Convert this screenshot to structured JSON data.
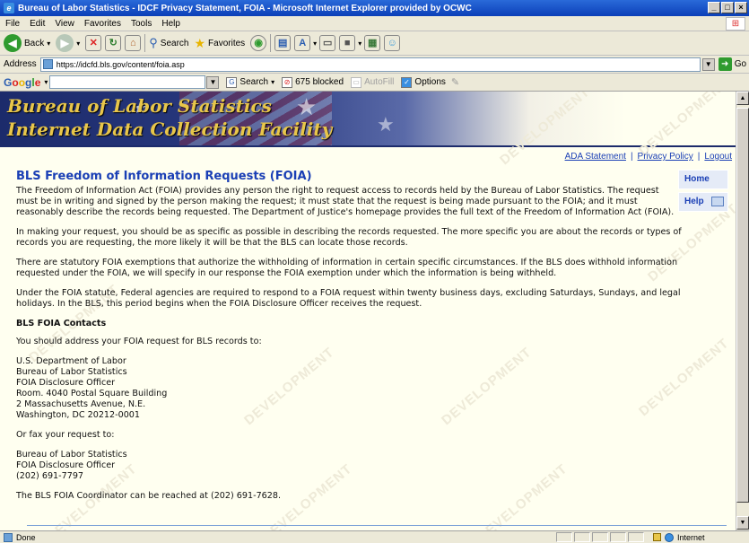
{
  "window": {
    "title": "Bureau of Labor Statistics - IDCF Privacy Statement, FOIA - Microsoft Internet Explorer provided by OCWC",
    "controls": [
      "_",
      "□",
      "×"
    ]
  },
  "menu": {
    "items": [
      "File",
      "Edit",
      "View",
      "Favorites",
      "Tools",
      "Help"
    ]
  },
  "toolbar": {
    "back_label": "Back",
    "search_label": "Search",
    "favorites_label": "Favorites"
  },
  "address": {
    "label": "Address",
    "url": "https://idcfd.bls.gov/content/foia.asp",
    "go_label": "Go"
  },
  "googlebar": {
    "logo": "Google",
    "search_label": "Search",
    "blocked_label": "675 blocked",
    "autofill_label": "AutoFill",
    "options_label": "Options"
  },
  "banner": {
    "line1": "Bureau of Labor Statistics",
    "line2": "Internet Data Collection Facility"
  },
  "toplinks": {
    "ada": "ADA Statement",
    "privacy": "Privacy Policy",
    "logout": "Logout"
  },
  "sidenav": {
    "home": "Home",
    "help": "Help"
  },
  "watermark": "DEVELOPMENT",
  "content": {
    "title": "BLS Freedom of Information Requests (FOIA)",
    "p1": "The Freedom of Information Act (FOIA) provides any person the right to request access to records held by the Bureau of Labor Statistics. The request must be in writing and signed by the person making the request; it must state that the request is being made pursuant to the FOIA; and it must reasonably describe the records being requested. The Department of Justice's homepage provides the full text of the Freedom of Information Act (FOIA).",
    "p2": "In making your request, you should be as specific as possible in describing the records requested. The more specific you are about the records or types of records you are requesting, the more likely it will be that the BLS can locate those records.",
    "p3": "There are statutory FOIA exemptions that authorize the withholding of information in certain specific circumstances. If the BLS does withhold information requested under the FOIA, we will specify in our response the FOIA exemption under which the information is being withheld.",
    "p4": "Under the FOIA statute, Federal agencies are required to respond to a FOIA request within twenty business days, excluding Saturdays, Sundays, and legal holidays. In the BLS, this period begins when the FOIA Disclosure Officer receives the request.",
    "contacts_heading": "BLS FOIA Contacts",
    "address_intro": "You should address your FOIA request for BLS records to:",
    "address_lines": [
      "U.S. Department of Labor",
      "Bureau of Labor Statistics",
      "FOIA Disclosure Officer",
      "Room. 4040 Postal Square Building",
      "2 Massachusetts Avenue, N.E.",
      "Washington, DC 20212-0001"
    ],
    "fax_intro": "Or fax your request to:",
    "fax_lines": [
      "Bureau of Labor Statistics",
      "FOIA Disclosure Officer",
      "(202) 691-7797"
    ],
    "coordinator": "The BLS FOIA Coordinator can be reached at (202) 691-7628."
  },
  "status": {
    "text": "Done",
    "zone": "Internet"
  }
}
